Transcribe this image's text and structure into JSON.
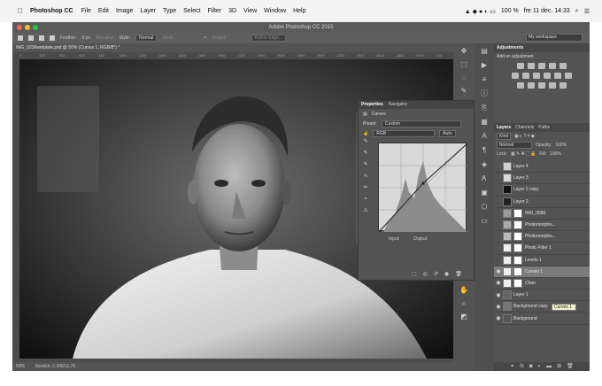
{
  "menubar": {
    "apple": "",
    "app": "Photoshop CC",
    "items": [
      "File",
      "Edit",
      "Image",
      "Layer",
      "Type",
      "Select",
      "Filter",
      "3D",
      "View",
      "Window",
      "Help"
    ],
    "battery": "100 %",
    "clock": "fre 11 dec.  14:33"
  },
  "window": {
    "title": "Adobe Photoshop CC 2015"
  },
  "options": {
    "feather_label": "Feather:",
    "feather_value": "0 px",
    "antialias": "Anti-alias",
    "style_label": "Style:",
    "style_value": "Normal",
    "width_label": "Width:",
    "height_label": "Height:",
    "refine": "Refine Edge...",
    "workspace": "My workspace"
  },
  "document": {
    "tab": "IMG_0236wetplate.psd @ 50% (Curves 1, RGB/8*) *",
    "ruler": [
      "0",
      "200",
      "400",
      "600",
      "800",
      "1000",
      "1200",
      "1400",
      "1600",
      "1800",
      "2000",
      "2200",
      "2400",
      "2600",
      "2800",
      "3000",
      "3200",
      "3400",
      "3600",
      "3800",
      "4000",
      "420"
    ],
    "zoom": "50%",
    "scratch": "Scratch: 2,300/11,70"
  },
  "properties": {
    "tabs": [
      "Properties",
      "Navigator"
    ],
    "type": "Curves",
    "preset_label": "Preset:",
    "preset_value": "Custom",
    "channel": "RGB",
    "auto": "Auto",
    "input_label": "Input:",
    "output_label": "Output:"
  },
  "adjustments": {
    "title": "Adjustments",
    "subtitle": "Add an adjustment"
  },
  "layers_panel": {
    "tabs": [
      "Layers",
      "Channels",
      "Paths"
    ],
    "filter": "Kind",
    "blend": "Normal",
    "opacity_label": "Opacity:",
    "opacity": "100%",
    "lock_label": "Lock:",
    "fill_label": "Fill:",
    "fill": "100%",
    "layers": [
      {
        "name": "Layer 4",
        "selected": false
      },
      {
        "name": "Layer 3",
        "selected": false
      },
      {
        "name": "Layer 2 copy",
        "selected": false
      },
      {
        "name": "Layer 2",
        "selected": false
      },
      {
        "name": "IMG_0580",
        "selected": false
      },
      {
        "name": "Photomorphis...",
        "selected": false
      },
      {
        "name": "Photomorphis...",
        "selected": false
      },
      {
        "name": "Photo Filter 1",
        "selected": false
      },
      {
        "name": "Levels 1",
        "selected": false
      },
      {
        "name": "Curves 1",
        "selected": true
      },
      {
        "name": "Chan",
        "selected": false
      },
      {
        "name": "Layer 1",
        "selected": false
      },
      {
        "name": "Background copy",
        "selected": false
      },
      {
        "name": "Background",
        "selected": false
      }
    ],
    "tooltip": "Curves 1"
  },
  "chart_data": {
    "type": "area",
    "title": "",
    "curve": [
      [
        0,
        0
      ],
      [
        0.5,
        0.55
      ],
      [
        1,
        1
      ]
    ]
  }
}
